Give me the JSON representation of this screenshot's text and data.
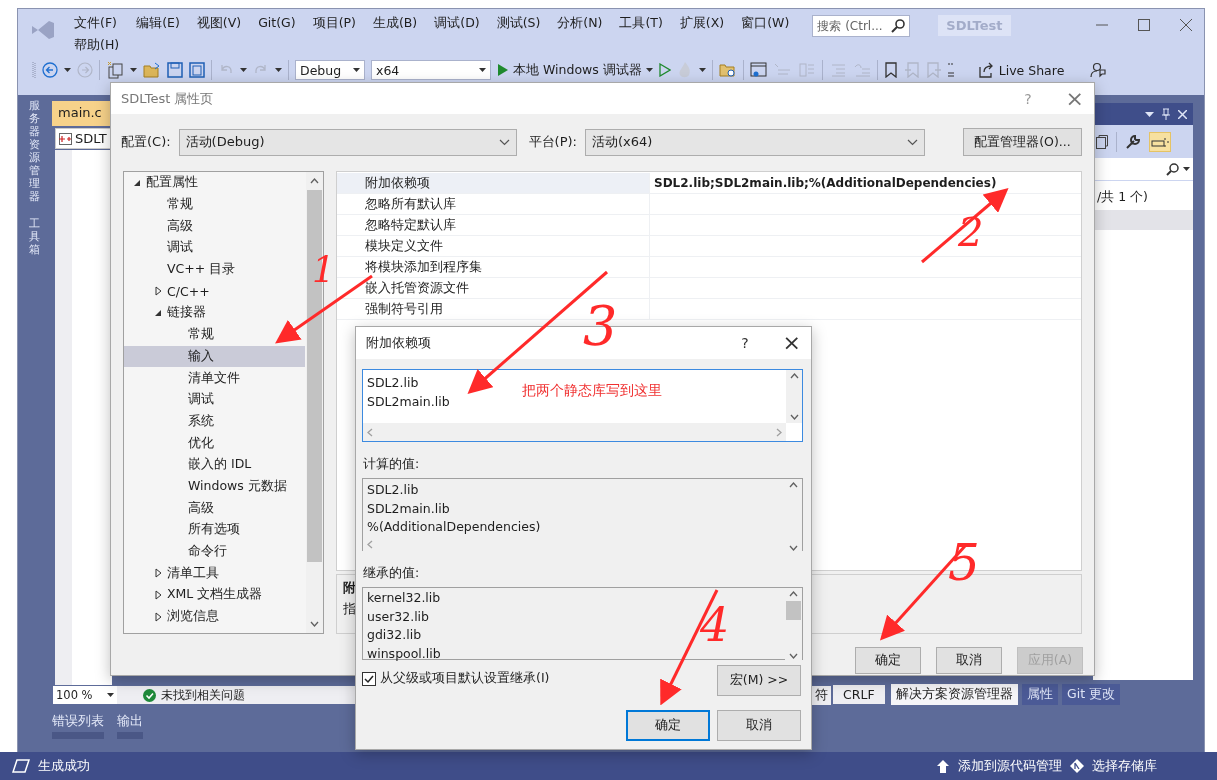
{
  "ide": {
    "menu": [
      "文件(F)",
      "编辑(E)",
      "视图(V)",
      "Git(G)",
      "项目(P)",
      "生成(B)",
      "调试(D)",
      "测试(S)",
      "分析(N)",
      "工具(T)",
      "扩展(X)",
      "窗口(W)",
      "帮助(H)"
    ],
    "search": {
      "placeholder": "搜索 (Ctrl..."
    },
    "solution_name": "SDLTest",
    "toolbar": {
      "configuration": "Debug",
      "platform": "x64",
      "debugger": "本地 Windows 调试器",
      "live_share": "Live Share"
    },
    "side_tabs": [
      "服务器资源管理器",
      "工具箱"
    ],
    "editor_tab": "main.c",
    "project_selector": "SDLT",
    "zoom": "100 %",
    "issues": "未找到相关问题",
    "bottom_tabs": [
      "错误列表",
      "输出"
    ],
    "status": "生成成功",
    "line_info": [
      "符",
      "CRLF"
    ],
    "panel_tabs": [
      {
        "label": "解决方案资源管理器",
        "selected": true
      },
      {
        "label": "属性",
        "selected": false
      },
      {
        "label": "Git 更改",
        "selected": false
      }
    ],
    "solution_summary": "/共 1 个)",
    "source_control": [
      "添加到源代码管理",
      "选择存储库"
    ]
  },
  "property_pages": {
    "title": "SDLTest 属性页",
    "help": "?",
    "close": "×",
    "configuration_label": "配置(C):",
    "configuration": "活动(Debug)",
    "platform_label": "平台(P):",
    "platform": "活动(x64)",
    "manager_button": "配置管理器(O)...",
    "tree": [
      {
        "label": "配置属性",
        "expanded": true,
        "selected": false,
        "children": [
          {
            "label": "常规",
            "selected": false
          },
          {
            "label": "高级",
            "selected": false
          },
          {
            "label": "调试",
            "selected": false
          },
          {
            "label": "VC++ 目录",
            "selected": false
          },
          {
            "label": "C/C++",
            "expanded": false,
            "selected": false
          },
          {
            "label": "链接器",
            "expanded": true,
            "selected": false,
            "children": [
              {
                "label": "常规",
                "selected": false
              },
              {
                "label": "输入",
                "selected": true
              },
              {
                "label": "清单文件",
                "selected": false
              },
              {
                "label": "调试",
                "selected": false
              },
              {
                "label": "系统",
                "selected": false
              },
              {
                "label": "优化",
                "selected": false
              },
              {
                "label": "嵌入的 IDL",
                "selected": false
              },
              {
                "label": "Windows 元数据",
                "selected": false
              },
              {
                "label": "高级",
                "selected": false
              },
              {
                "label": "所有选项",
                "selected": false
              },
              {
                "label": "命令行",
                "selected": false
              }
            ]
          },
          {
            "label": "清单工具",
            "expanded": false,
            "selected": false
          },
          {
            "label": "XML 文档生成器",
            "expanded": false,
            "selected": false
          },
          {
            "label": "浏览信息",
            "expanded": false,
            "selected": false
          }
        ]
      }
    ],
    "properties": [
      {
        "name": "附加依赖项",
        "value": "SDL2.lib;SDL2main.lib;%(AdditionalDependencies)",
        "selected": true
      },
      {
        "name": "忽略所有默认库",
        "selected": false
      },
      {
        "name": "忽略特定默认库",
        "selected": false
      },
      {
        "name": "模块定义文件",
        "selected": false
      },
      {
        "name": "将模块添加到程序集",
        "selected": false
      },
      {
        "name": "嵌入托管资源文件",
        "selected": false
      },
      {
        "name": "强制符号引用",
        "selected": false
      }
    ],
    "description": [
      "附",
      "指"
    ],
    "buttons": [
      {
        "label": "确定",
        "disabled": false
      },
      {
        "label": "取消",
        "disabled": false
      },
      {
        "label": "应用(A)",
        "disabled": true
      }
    ]
  },
  "dependencies_dialog": {
    "title": "附加依赖项",
    "help": "?",
    "close": "×",
    "lines": [
      "SDL2.lib",
      "SDL2main.lib"
    ],
    "computed_label": "计算的值:",
    "computed": [
      "SDL2.lib",
      "SDL2main.lib",
      "%(AdditionalDependencies)"
    ],
    "inherited_label": "继承的值:",
    "inherited": [
      "kernel32.lib",
      "user32.lib",
      "gdi32.lib",
      "winspool.lib"
    ],
    "inherit": {
      "label": "从父级或项目默认设置继承(I)",
      "checked": true
    },
    "macro_button": "宏(M) >>",
    "buttons": [
      {
        "label": "确定",
        "focused": true
      },
      {
        "label": "取消",
        "focused": false
      }
    ]
  },
  "annotations": {
    "numbers": [
      "1",
      "2",
      "3",
      "4",
      "5"
    ],
    "note": "把两个静态库写到这里"
  }
}
